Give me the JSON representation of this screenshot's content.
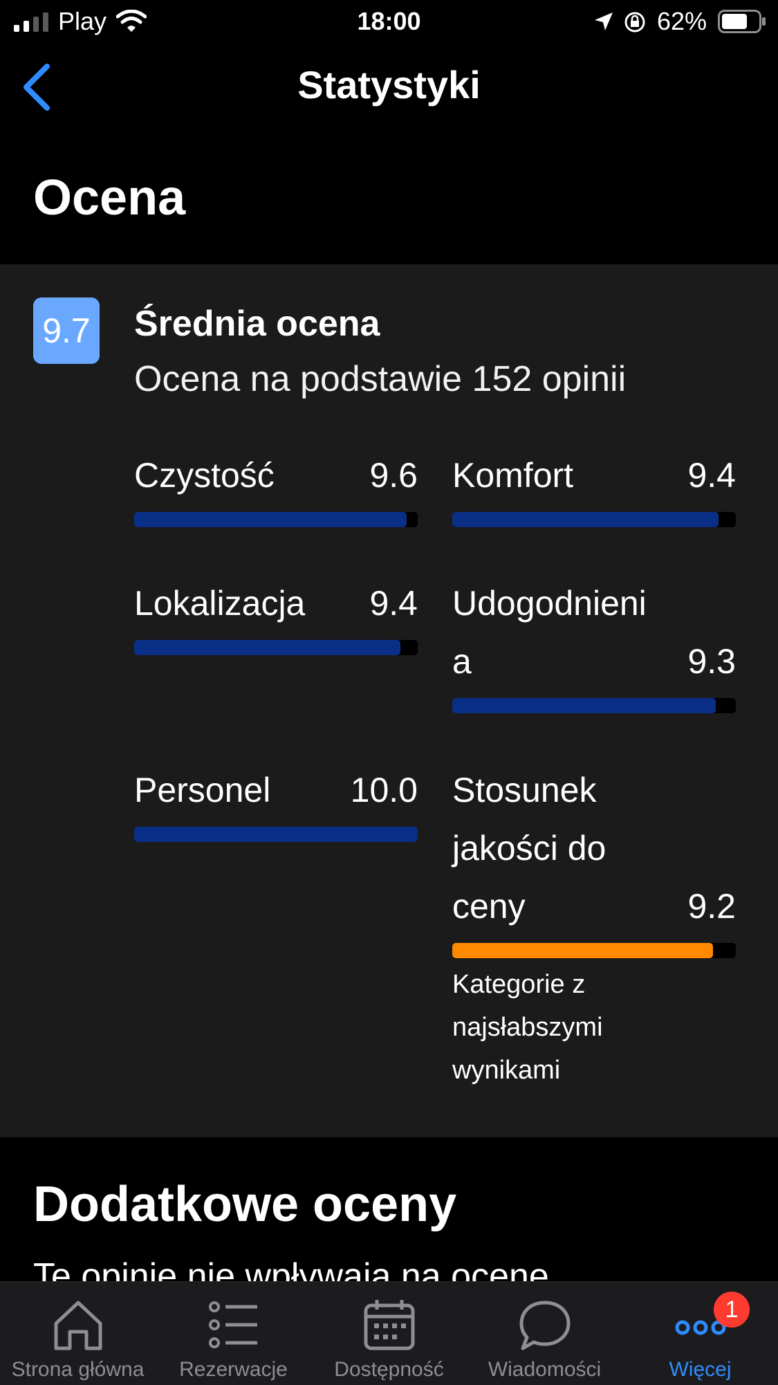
{
  "status": {
    "carrier": "Play",
    "time": "18:00",
    "battery": "62%"
  },
  "nav": {
    "title": "Statystyki"
  },
  "section_title": "Ocena",
  "rating": {
    "score": "9.7",
    "title": "Średnia ocena",
    "subtitle": "Ocena na podstawie 152 opinii",
    "metrics": [
      {
        "label_lines": [
          "Czystość"
        ],
        "value": "9.6",
        "fraction": 0.96,
        "color": "#0a2f86"
      },
      {
        "label_lines": [
          "Komfort"
        ],
        "value": "9.4",
        "fraction": 0.94,
        "color": "#0a2f86"
      },
      {
        "label_lines": [
          "Lokalizacja"
        ],
        "value": "9.4",
        "fraction": 0.94,
        "color": "#0a2f86"
      },
      {
        "label_lines": [
          "Udogodnieni",
          "a"
        ],
        "value": "9.3",
        "fraction": 0.93,
        "color": "#0a2f86"
      },
      {
        "label_lines": [
          "Personel"
        ],
        "value": "10.0",
        "fraction": 1.0,
        "color": "#0a2f86"
      },
      {
        "label_lines": [
          "Stosunek",
          "jakości do",
          "ceny"
        ],
        "value": "9.2",
        "fraction": 0.92,
        "color": "#ff8a00"
      }
    ],
    "weakest_note_lines": [
      "Kategorie z",
      "najsłabszymi",
      "wynikami"
    ]
  },
  "extra": {
    "title": "Dodatkowe oceny",
    "subtitle": "Te opinie nie wpływają na ocenę"
  },
  "tabs": [
    {
      "label": "Strona główna",
      "icon": "home-icon"
    },
    {
      "label": "Rezerwacje",
      "icon": "list-icon"
    },
    {
      "label": "Dostępność",
      "icon": "calendar-icon"
    },
    {
      "label": "Wiadomości",
      "icon": "chat-bubble-icon"
    },
    {
      "label": "Więcej",
      "icon": "more-dots-icon",
      "active": true,
      "badge": "1"
    }
  ],
  "colors": {
    "accent": "#2f8cff",
    "score_badge": "#6aa8ff",
    "bar_normal": "#0a2f86",
    "bar_weak": "#ff8a00",
    "card_bg": "#1b1b1c"
  }
}
